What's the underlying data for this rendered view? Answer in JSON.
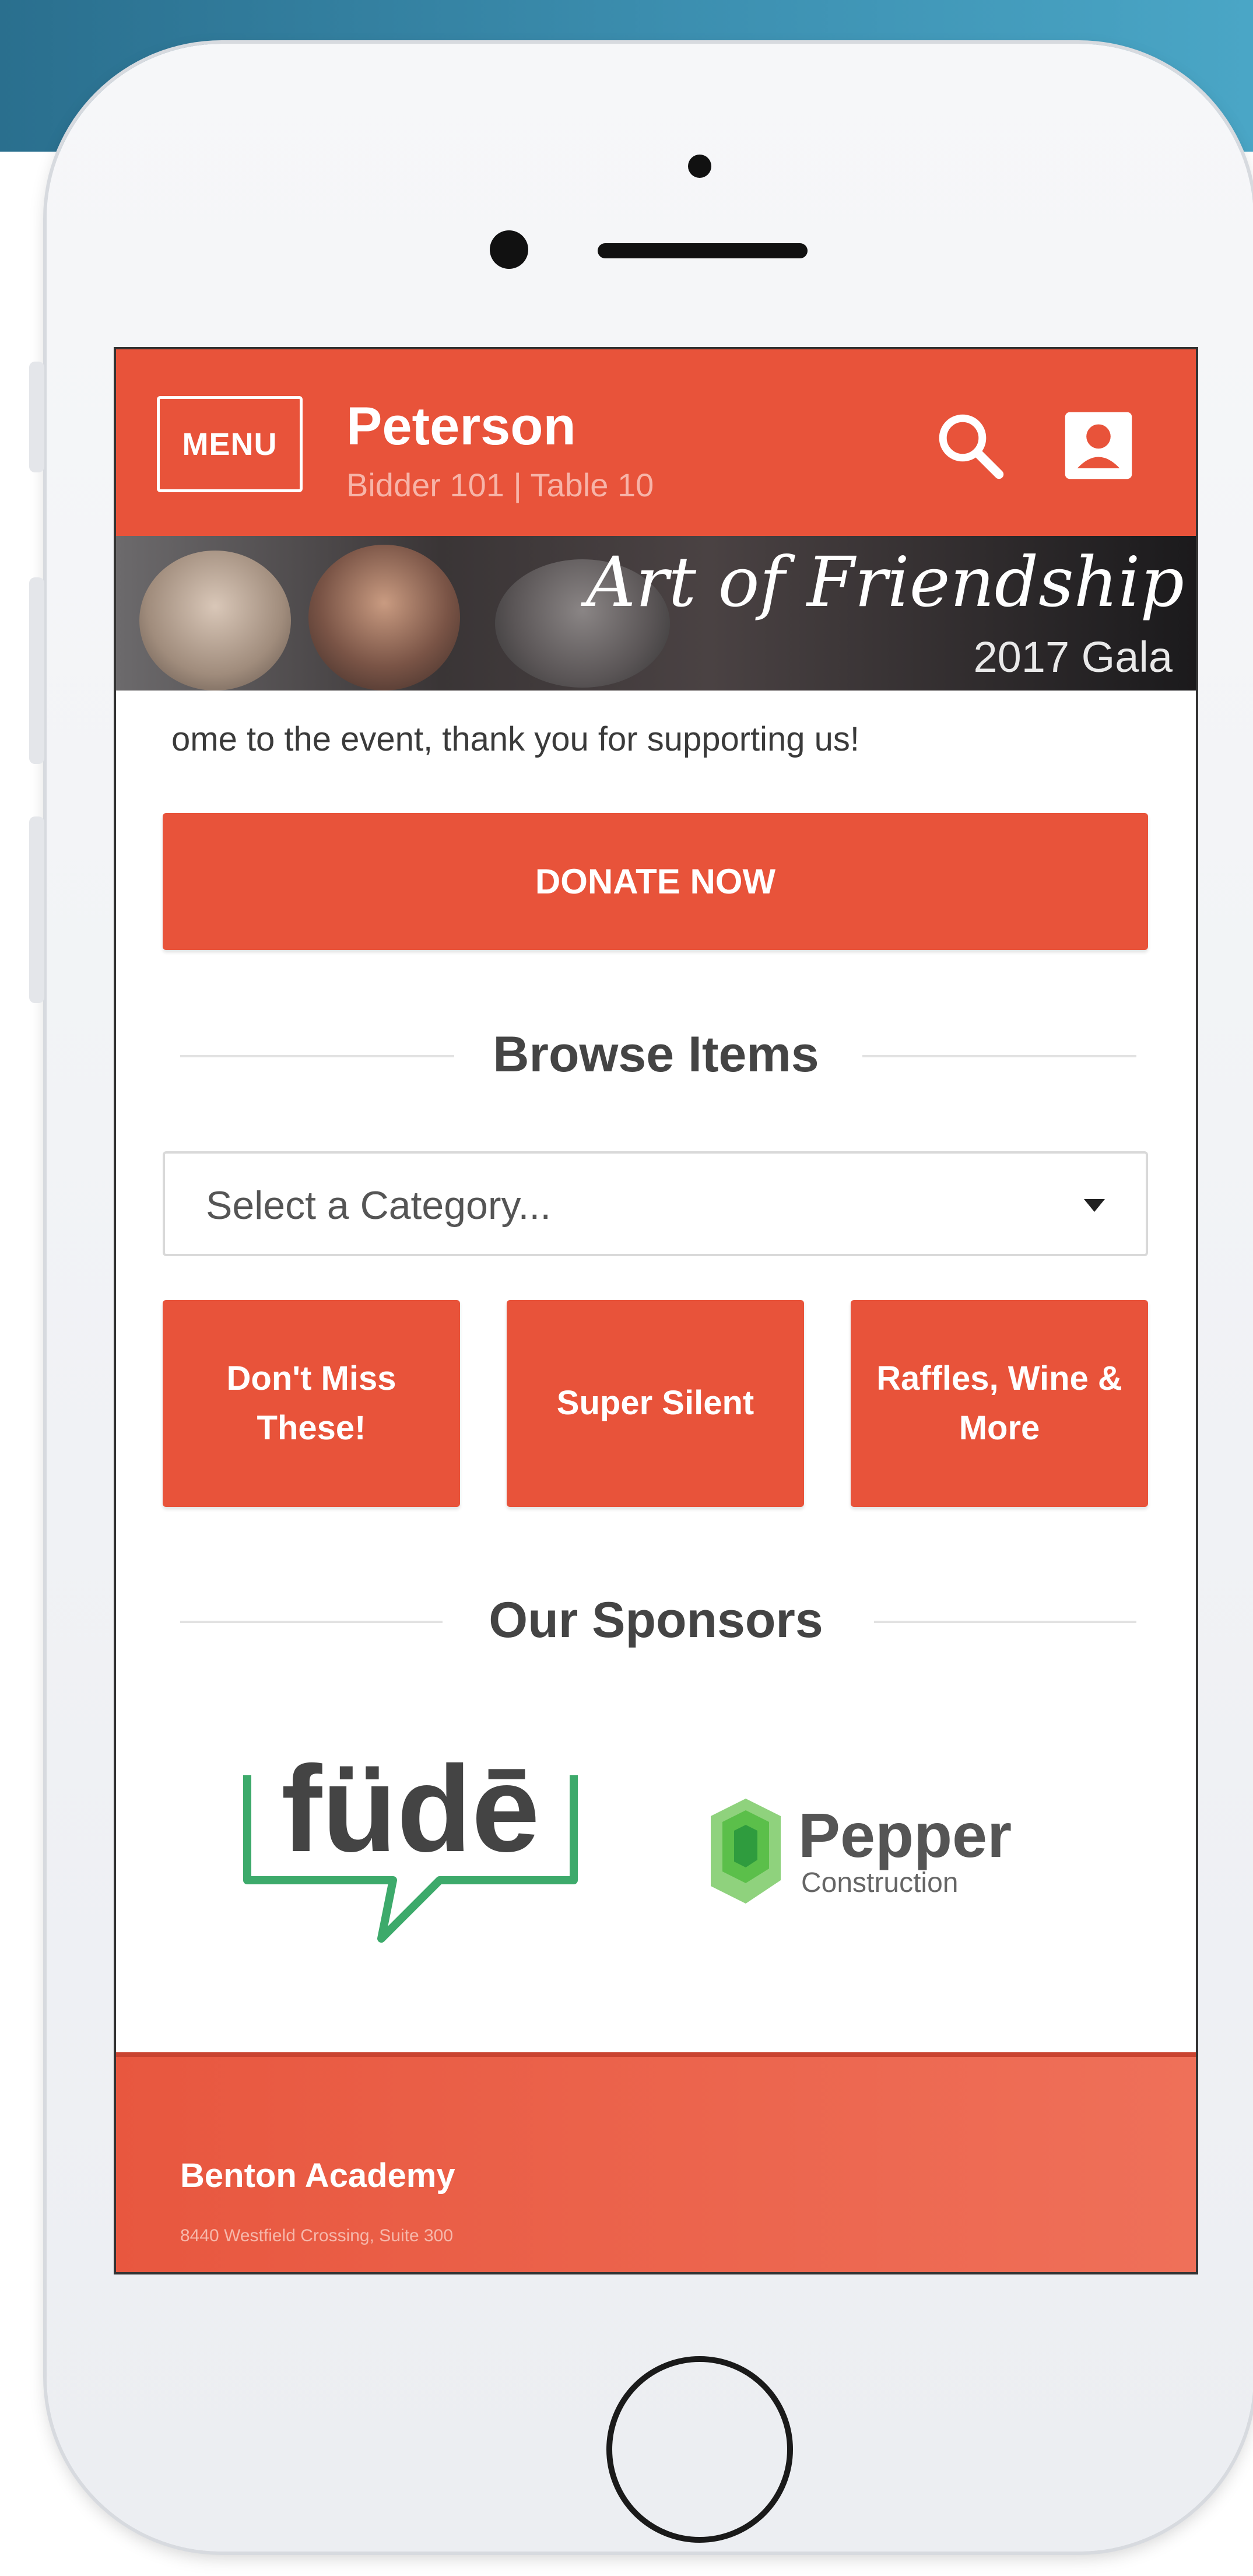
{
  "header": {
    "menu_label": "MENU",
    "bidder_name": "Peterson",
    "bidder_info": "Bidder 101 | Table 10",
    "search_icon": "search-icon",
    "account_icon": "account-icon"
  },
  "banner": {
    "title": "Art of Friendship",
    "subtitle": "2017 Gala"
  },
  "welcome_text": "ome to the event, thank you for supporting us!",
  "donate": {
    "label": "DONATE NOW"
  },
  "browse": {
    "title": "Browse Items",
    "select_placeholder": "Select a Category...",
    "tiles": [
      "Don't Miss These!",
      "Super Silent",
      "Raffles, Wine & More"
    ]
  },
  "sponsors": {
    "title": "Our Sponsors",
    "items": [
      {
        "name": "füdē"
      },
      {
        "name": "Pepper",
        "subtitle": "Construction"
      }
    ]
  },
  "footer": {
    "org_name": "Benton Academy",
    "address": "8440 Westfield Crossing, Suite 300"
  },
  "colors": {
    "primary": "#e8533a",
    "footer": "#ef6f58",
    "sponsor_green": "#3daa6b",
    "pepper_green": "#5bbf4a"
  }
}
